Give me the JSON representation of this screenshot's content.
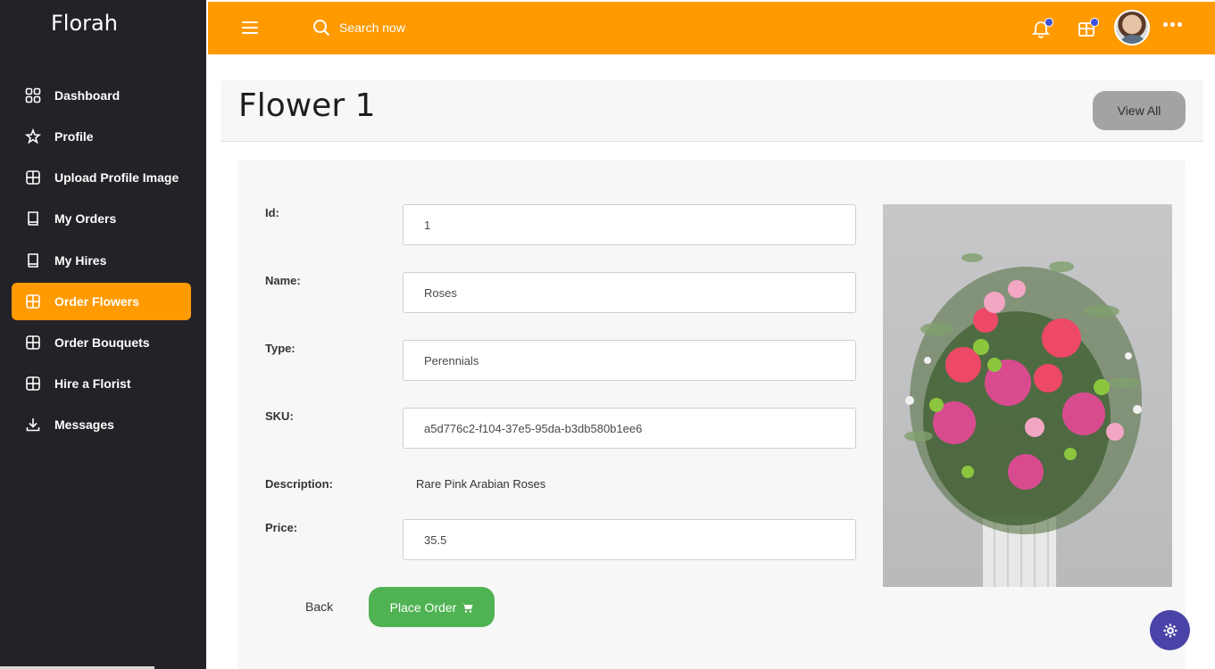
{
  "app": {
    "brand": "Florah"
  },
  "sidebar": {
    "items": [
      {
        "label": "Dashboard",
        "icon": "dashboard-icon"
      },
      {
        "label": "Profile",
        "icon": "star-icon"
      },
      {
        "label": "Upload Profile Image",
        "icon": "grid-icon"
      },
      {
        "label": "My Orders",
        "icon": "book-icon"
      },
      {
        "label": "My Hires",
        "icon": "book-icon"
      },
      {
        "label": "Order Flowers",
        "icon": "grid-icon",
        "active": true
      },
      {
        "label": "Order Bouquets",
        "icon": "grid-icon"
      },
      {
        "label": "Hire a Florist",
        "icon": "grid-icon"
      },
      {
        "label": "Messages",
        "icon": "download-icon"
      }
    ]
  },
  "topbar": {
    "search_placeholder": "Search now",
    "accent": "#ff9a00",
    "badge_color": "#3d53d8"
  },
  "page": {
    "title": "Flower 1",
    "view_all_label": "View All"
  },
  "form": {
    "id_label": "Id:",
    "id_value": "1",
    "name_label": "Name:",
    "name_value": "Roses",
    "type_label": "Type:",
    "type_value": "Perennials",
    "sku_label": "SKU:",
    "sku_value": "a5d776c2-f104-37e5-95da-b3db580b1ee6",
    "description_label": "Description:",
    "description_value": "Rare Pink Arabian Roses",
    "price_label": "Price:",
    "price_value": "35.5"
  },
  "actions": {
    "back_label": "Back",
    "place_order_label": "Place Order"
  },
  "colors": {
    "sidebar_bg": "#222227",
    "place_order": "#4fb353",
    "settings_fab": "#4a44a8"
  }
}
